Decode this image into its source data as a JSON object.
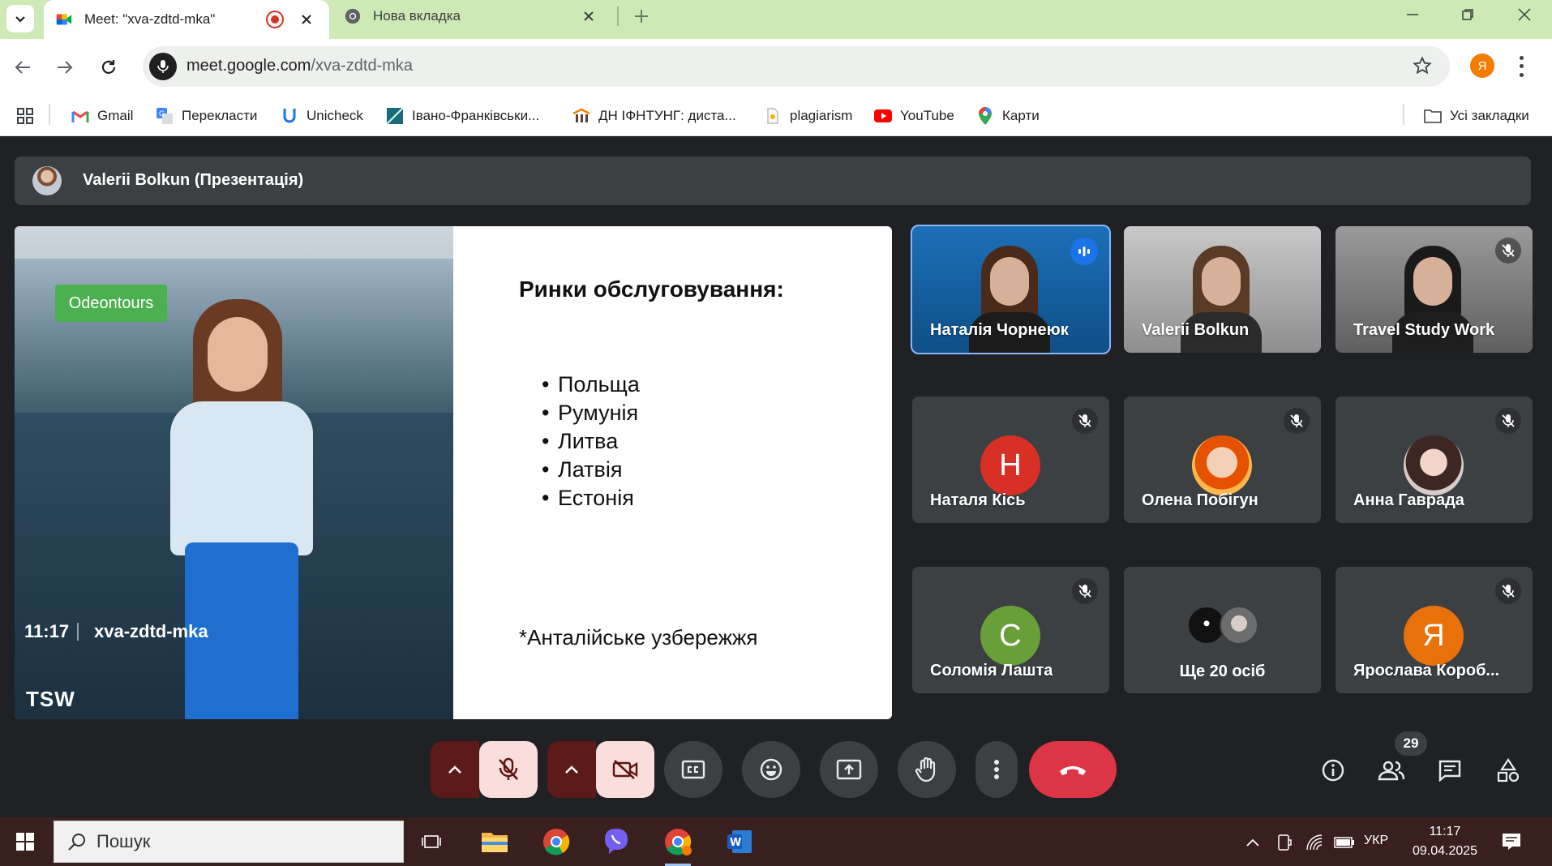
{
  "browser": {
    "tabs": [
      {
        "title": "Meet: \"xva-zdtd-mka\"",
        "active": true,
        "recording": true
      },
      {
        "title": "Нова вкладка",
        "active": false
      }
    ],
    "url_host": "meet.google.com",
    "url_path": "/xva-zdtd-mka",
    "profile_initial": "Я",
    "bookmarks": [
      {
        "label": "Gmail",
        "icon": "gmail-icon"
      },
      {
        "label": "Перекласти",
        "icon": "translate-icon"
      },
      {
        "label": "Unicheck",
        "icon": "unicheck-icon"
      },
      {
        "label": "Івано-Франківськи...",
        "icon": "site-icon"
      },
      {
        "label": "ДН ІФНТУНГ: диста...",
        "icon": "university-icon"
      },
      {
        "label": "plagiarism",
        "icon": "plagiarism-icon"
      },
      {
        "label": "YouTube",
        "icon": "youtube-icon"
      },
      {
        "label": "Карти",
        "icon": "maps-icon"
      }
    ],
    "all_bookmarks": "Усі закладки"
  },
  "meet": {
    "presenter_label": "Valerii Bolkun (Презентація)",
    "slide": {
      "photo_brand": "Odeontours",
      "photo_logo": "TSW",
      "title": "Ринки обслуговування:",
      "items": [
        "Польща",
        "Румунія",
        "Литва",
        "Латвія",
        "Естонія"
      ],
      "note": "*Анталійське узбережжя"
    },
    "participants": [
      {
        "name": "Наталія Чорнеюк",
        "type": "video",
        "speaking": true
      },
      {
        "name": "Valerii Bolkun",
        "type": "video"
      },
      {
        "name": "Travel Study Work",
        "type": "video",
        "muted": true
      },
      {
        "name": "Наталя Кісь",
        "type": "initial",
        "initial": "Н",
        "color": "#d93025",
        "muted": true
      },
      {
        "name": "Олена Побігун",
        "type": "photo",
        "muted": true
      },
      {
        "name": "Анна Гаврада",
        "type": "photo",
        "muted": true
      },
      {
        "name": "Соломія Лашта",
        "type": "initial",
        "initial": "С",
        "color": "#689f38",
        "muted": true
      },
      {
        "name": "Ще 20 осіб",
        "type": "more"
      },
      {
        "name": "Ярослава Короб...",
        "type": "initial",
        "initial": "Я",
        "color": "#e8710a",
        "muted": true
      }
    ],
    "time": "11:17",
    "meeting_code": "xva-zdtd-mka",
    "people_count": "29"
  },
  "taskbar": {
    "search_placeholder": "Пошук",
    "language": "УКР",
    "time": "11:17",
    "date": "09.04.2025"
  }
}
